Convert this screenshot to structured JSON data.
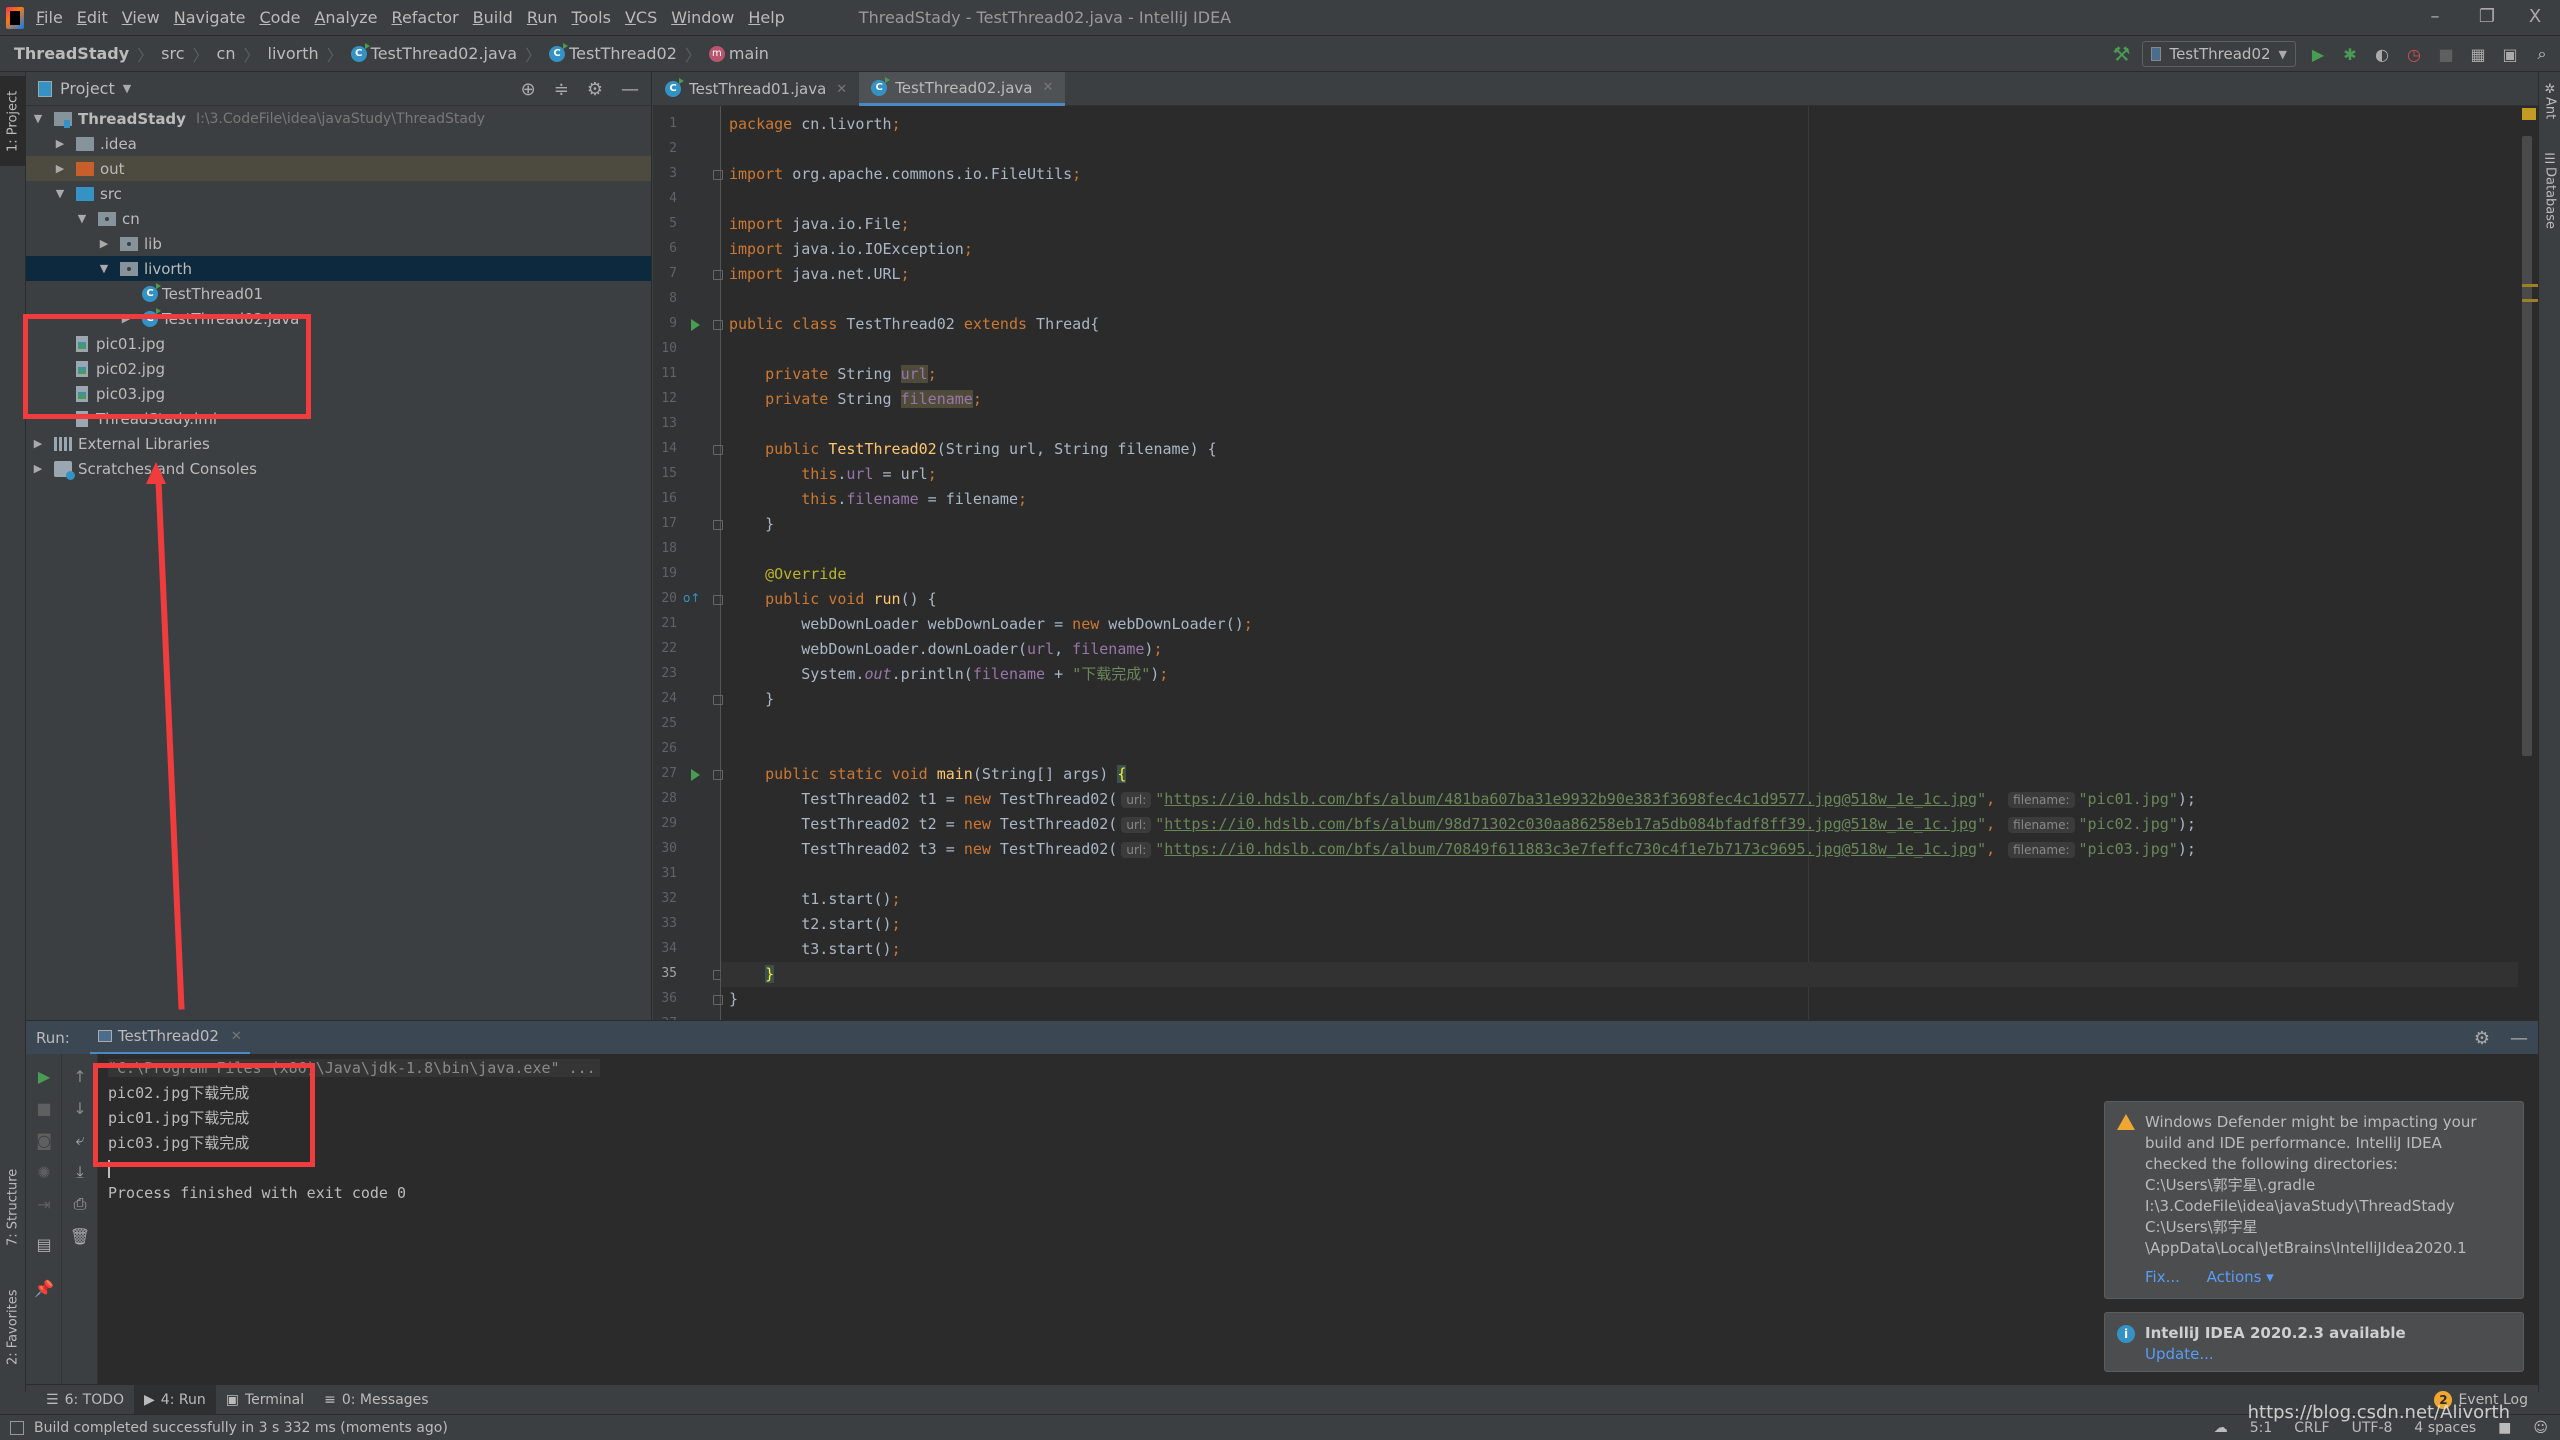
{
  "menubar": {
    "items": [
      "File",
      "Edit",
      "View",
      "Navigate",
      "Code",
      "Analyze",
      "Refactor",
      "Build",
      "Run",
      "Tools",
      "VCS",
      "Window",
      "Help"
    ],
    "window_title": "ThreadStady - TestThread02.java - IntelliJ IDEA",
    "controls": {
      "minimize": "–",
      "restore": "❐",
      "close": "X"
    }
  },
  "breadcrumb": {
    "items": [
      "ThreadStady",
      "src",
      "cn",
      "livorth",
      "TestThread02.java",
      "TestThread02",
      "main"
    ]
  },
  "toolbar": {
    "run_config": "TestThread02"
  },
  "left_stripe": {
    "project": "1: Project",
    "structure": "7: Structure",
    "favorites": "2: Favorites"
  },
  "right_stripe": {
    "ant": "Ant",
    "database": "Database"
  },
  "project_panel": {
    "title": "Project",
    "tree": [
      {
        "label": "ThreadStady",
        "hint": "I:\\3.CodeFile\\idea\\javaStudy\\ThreadStady",
        "depth": 0,
        "state": "expanded",
        "icon": "module-folder-icon"
      },
      {
        "label": ".idea",
        "depth": 1,
        "state": "collapsed",
        "icon": "folder-icon"
      },
      {
        "label": "out",
        "depth": 1,
        "state": "collapsed",
        "icon": "excluded-folder-icon"
      },
      {
        "label": "src",
        "depth": 1,
        "state": "expanded",
        "icon": "source-folder-icon"
      },
      {
        "label": "cn",
        "depth": 2,
        "state": "expanded",
        "icon": "package-icon"
      },
      {
        "label": "lib",
        "depth": 3,
        "state": "collapsed",
        "icon": "package-icon"
      },
      {
        "label": "livorth",
        "depth": 3,
        "state": "expanded",
        "icon": "package-icon",
        "selected": true
      },
      {
        "label": "TestThread01",
        "depth": 4,
        "state": "leaf",
        "icon": "java-class-icon"
      },
      {
        "label": "TestThread02.java",
        "depth": 4,
        "state": "collapsed",
        "icon": "java-class-icon"
      },
      {
        "label": "pic01.jpg",
        "depth": 1,
        "state": "leaf",
        "icon": "image-file-icon"
      },
      {
        "label": "pic02.jpg",
        "depth": 1,
        "state": "leaf",
        "icon": "image-file-icon"
      },
      {
        "label": "pic03.jpg",
        "depth": 1,
        "state": "leaf",
        "icon": "image-file-icon"
      },
      {
        "label": "ThreadStady.iml",
        "depth": 1,
        "state": "leaf",
        "icon": "iml-file-icon"
      },
      {
        "label": "External Libraries",
        "depth": 0,
        "state": "collapsed",
        "icon": "library-icon"
      },
      {
        "label": "Scratches and Consoles",
        "depth": 0,
        "state": "collapsed",
        "icon": "scratches-icon"
      }
    ]
  },
  "editor": {
    "tabs": [
      {
        "label": "TestThread01.java",
        "active": false
      },
      {
        "label": "TestThread02.java",
        "active": true
      }
    ],
    "current_line": 35,
    "lines": [
      "package cn.livorth;",
      "",
      "import org.apache.commons.io.FileUtils;",
      "",
      "import java.io.File;",
      "import java.io.IOException;",
      "import java.net.URL;",
      "",
      "public class TestThread02 extends Thread{",
      "",
      "    private String url;",
      "    private String filename;",
      "",
      "    public TestThread02(String url, String filename) {",
      "        this.url = url;",
      "        this.filename = filename;",
      "    }",
      "",
      "    @Override",
      "    public void run() {",
      "        webDownLoader webDownLoader = new webDownLoader();",
      "        webDownLoader.downLoader(url, filename);",
      "        System.out.println(filename + \"下载完成\");",
      "    }",
      "",
      "",
      "    public static void main(String[] args) {",
      "        TestThread02 t1 = new TestThread02(url: \"https://i0.hdslb.com/bfs/album/481ba607ba31e9932b90e383f3698fec4c1d9577.jpg@518w_1e_1c.jpg\", filename: \"pic01.jpg\");",
      "        TestThread02 t2 = new TestThread02(url: \"https://i0.hdslb.com/bfs/album/98d71302c030aa86258eb17a5db084bfadf8ff39.jpg@518w_1e_1c.jpg\", filename: \"pic02.jpg\");",
      "        TestThread02 t3 = new TestThread02(url: \"https://i0.hdslb.com/bfs/album/70849f611883c3e7feffc730c4f1e7b7173c9695.jpg@518w_1e_1c.jpg\", filename: \"pic03.jpg\");",
      "",
      "        t1.start();",
      "        t2.start();",
      "        t3.start();",
      "    }",
      "}",
      ""
    ],
    "threads": [
      {
        "var": "t1",
        "url": "https://i0.hdslb.com/bfs/album/481ba607ba31e9932b90e383f3698fec4c1d9577.jpg@518w_1e_1c.jpg",
        "filename": "pic01.jpg"
      },
      {
        "var": "t2",
        "url": "https://i0.hdslb.com/bfs/album/98d71302c030aa86258eb17a5db084bfadf8ff39.jpg@518w_1e_1c.jpg",
        "filename": "pic02.jpg"
      },
      {
        "var": "t3",
        "url": "https://i0.hdslb.com/bfs/album/70849f611883c3e7feffc730c4f1e7b7173c9695.jpg@518w_1e_1c.jpg",
        "filename": "pic03.jpg"
      }
    ],
    "hint_url": "url:",
    "hint_filename": "filename:",
    "print_suffix": "下载完成"
  },
  "run_panel": {
    "label": "Run:",
    "tab": "TestThread02",
    "console": [
      "\"C:\\Program Files (x86)\\Java\\jdk-1.8\\bin\\java.exe\" ...",
      "pic02.jpg下载完成",
      "pic01.jpg下载完成",
      "pic03.jpg下载完成",
      "",
      "Process finished with exit code 0"
    ]
  },
  "notifications": {
    "defender": {
      "lines": [
        "Windows Defender might be impacting your",
        "build and IDE performance. IntelliJ IDEA",
        "checked the following directories:",
        "C:\\Users\\郭宇星\\.gradle",
        "I:\\3.CodeFile\\idea\\javaStudy\\ThreadStady",
        "C:\\Users\\郭宇星",
        "\\AppData\\Local\\JetBrains\\IntelliJIdea2020.1"
      ],
      "fix": "Fix...",
      "actions": "Actions ▾"
    },
    "update": {
      "title": "IntelliJ IDEA 2020.2.3 available",
      "link": "Update..."
    }
  },
  "tool_tabs": {
    "todo": "6: TODO",
    "run": "4: Run",
    "terminal": "Terminal",
    "messages": "0: Messages",
    "event_log": "Event Log",
    "event_count": "2"
  },
  "statusbar": {
    "message": "Build completed successfully in 3 s 332 ms (moments ago)",
    "position": "5:1",
    "line_sep": "CRLF",
    "encoding": "UTF-8",
    "indent": "4 spaces"
  },
  "watermark": "https://blog.csdn.net/Alivorth",
  "colors": {
    "keyword": "#cc7832",
    "string": "#6a8759",
    "field": "#9876aa",
    "method": "#ffc66d",
    "annotation": "#bbb529",
    "accent": "#4a88c7",
    "annotation_box": "#f03c3c"
  }
}
